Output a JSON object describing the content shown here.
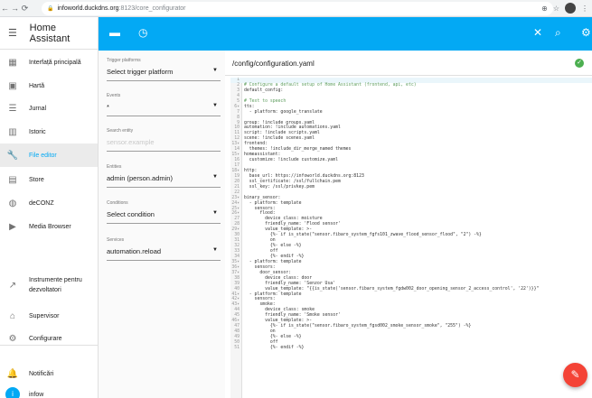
{
  "browser": {
    "url_host": "infoworld.duckdns.org",
    "url_path": ":8123/core_configurator"
  },
  "sidebar": {
    "title": "Home Assistant",
    "items": [
      {
        "label": "Interfață principală",
        "icon": "dashboard-icon",
        "glyph": "▦"
      },
      {
        "label": "Hartă",
        "icon": "map-icon",
        "glyph": "▣"
      },
      {
        "label": "Jurnal",
        "icon": "logbook-icon",
        "glyph": "☰"
      },
      {
        "label": "Istoric",
        "icon": "history-chart-icon",
        "glyph": "▥"
      },
      {
        "label": "File editor",
        "icon": "wrench-icon",
        "glyph": "🔧",
        "active": true
      },
      {
        "label": "Store",
        "icon": "store-icon",
        "glyph": "▤"
      },
      {
        "label": "deCONZ",
        "icon": "deconz-icon",
        "glyph": "◍"
      },
      {
        "label": "Media Browser",
        "icon": "media-browser-icon",
        "glyph": "▶"
      }
    ],
    "bottom": [
      {
        "label": "Instrumente pentru",
        "label2": "dezvoltatori",
        "icon": "developer-tools-icon",
        "glyph": "↗"
      },
      {
        "label": "Supervisor",
        "icon": "supervisor-icon",
        "glyph": "⌂"
      },
      {
        "label": "Configurare",
        "icon": "settings-icon",
        "glyph": "⚙"
      },
      {
        "label": "Notificări",
        "icon": "bell-icon",
        "glyph": "🔔"
      },
      {
        "label": "infow",
        "icon": "user-initial",
        "glyph": "i"
      }
    ]
  },
  "left_panel": {
    "trigger_label": "Trigger platforms",
    "trigger_value": "Select trigger platform",
    "events_label": "Events",
    "events_value": "*",
    "entity_search_label": "Search entity",
    "entity_search_placeholder": "sensor.example",
    "entities_label": "Entities",
    "entities_value": "admin (person.admin)",
    "conditions_label": "Conditions",
    "conditions_value": "Select condition",
    "services_label": "Services",
    "services_value": "automation.reload"
  },
  "editor": {
    "path": "/config/configuration.yaml",
    "lines": [
      "",
      "# Configure a default setup of Home Assistant (frontend, api, etc)",
      "default_config:",
      "",
      "# Text to speech",
      "tts:",
      "  - platform: google_translate",
      "",
      "group: !include groups.yaml",
      "automation: !include automations.yaml",
      "script: !include scripts.yaml",
      "scene: !include scenes.yaml",
      "frontend:",
      "  themes: !include_dir_merge_named themes",
      "homeassistant:",
      "  customize: !include customize.yaml",
      "",
      "http:",
      "  base_url: https://infoworld.duckdns.org:8123",
      "  ssl_certificate: /ssl/fullchain.pem",
      "  ssl_key: /ssl/privkey.pem",
      "",
      "binary_sensor:",
      "  - platform: template",
      "    sensors:",
      "      flood:",
      "        device_class: moisture",
      "        friendly_name: 'Flood sensor'",
      "        value_template: >-",
      "          {%- if is_state(\"sensor.fibaro_system_fgfs101_zwave_flood_sensor_flood\", \"2\") -%}",
      "          on",
      "          {%- else -%}",
      "          off",
      "          {%- endif -%}",
      "  - platform: template",
      "    sensors:",
      "      door_sensor:",
      "        device_class: door",
      "        friendly_name: 'Senzor Usa'",
      "        value_template: \"{{is_state('sensor.fibaro_system_fgdw002_door_opening_sensor_2_access_control', '22')}}\"",
      "  - platform: template",
      "    sensors:",
      "      smoke:",
      "        device_class: smoke",
      "        friendly_name: 'Smoke sensor'",
      "        value_template: >-",
      "          {%- if is_state(\"sensor.fibaro_system_fgsd002_smoke_sensor_smoke\", \"255\") -%}",
      "          on",
      "          {%- else -%}",
      "          off",
      "          {%- endif -%}"
    ],
    "fold_lines": [
      6,
      13,
      15,
      18,
      23,
      24,
      25,
      26,
      29,
      35,
      36,
      37,
      41,
      42,
      43,
      46
    ]
  }
}
